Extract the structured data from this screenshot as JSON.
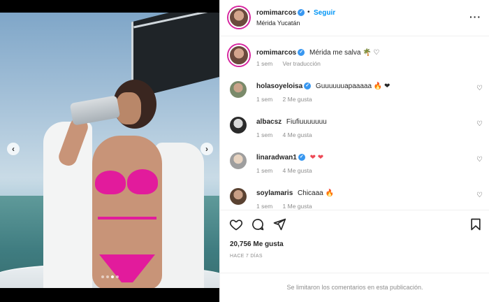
{
  "post": {
    "username": "romimarcos",
    "follow_separator": "•",
    "follow_label": "Seguir",
    "location": "Mérida Yucatán",
    "caption": {
      "username": "romimarcos",
      "text": "Mérida me salva 🌴 ♡",
      "time": "1 sem",
      "see_translation": "Ver traducción"
    },
    "likes": "20,756 Me gusta",
    "posted_ago": "HACE 7 DÍAS",
    "comments_limited": "Se limitaron los comentarios en esta publicación."
  },
  "comments": [
    {
      "username": "holasoyeloisa",
      "verified": true,
      "text": "Guuuuuuapaaaaa 🔥 ❤",
      "time": "1 sem",
      "likes": "2 Me gusta"
    },
    {
      "username": "albacsz",
      "verified": false,
      "text": "Fiufiuuuuuuu",
      "time": "1 sem",
      "likes": "4 Me gusta"
    },
    {
      "username": "linaradwan1",
      "verified": true,
      "text": "❤ ❤",
      "time": "1 sem",
      "likes": "4 Me gusta"
    },
    {
      "username": "soylamaris",
      "verified": false,
      "text": "Chicaaa 🔥",
      "time": "1 sem",
      "likes": "1 Me gusta"
    }
  ],
  "icons": {
    "more": "more-horizontal-icon",
    "prev": "chevron-left-icon",
    "next": "chevron-right-icon",
    "like": "heart-outline-icon",
    "comment": "comment-bubble-icon",
    "share": "paper-plane-icon",
    "save": "bookmark-icon"
  },
  "carousel": {
    "slides": 4,
    "active_index": 2
  },
  "colors": {
    "link_blue": "#0095f6",
    "verified_blue": "#3897f0",
    "muted": "#8e8e8e",
    "heart_red": "#ed4956",
    "bikini_pink": "#e21b9c"
  }
}
